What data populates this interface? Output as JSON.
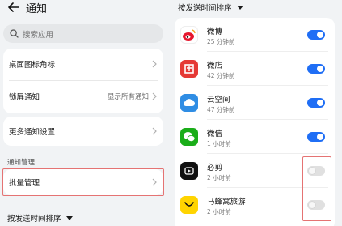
{
  "left_panel": {
    "title": "通知",
    "search_placeholder": "搜索应用",
    "items": [
      {
        "label": "桌面图标角标"
      },
      {
        "label": "锁屏通知",
        "value": "显示所有通知"
      },
      {
        "label": "更多通知设置"
      },
      {
        "label": "批量管理"
      }
    ],
    "section_label": "通知管理",
    "sort_label": "按发送时间排序"
  },
  "right_panel": {
    "sort_label": "按发送时间排序",
    "apps": [
      {
        "name": "微博",
        "time": "25 分钟前",
        "enabled": true,
        "icon": "weibo-icon",
        "color": "#ffffff"
      },
      {
        "name": "微店",
        "time": "42 分钟前",
        "enabled": true,
        "icon": "weidian-icon",
        "color": "#e53935"
      },
      {
        "name": "云空间",
        "time": "47 分钟前",
        "enabled": true,
        "icon": "cloud-icon",
        "color": "#2f8de4"
      },
      {
        "name": "微信",
        "time": "1 小时前",
        "enabled": true,
        "icon": "wechat-icon",
        "color": "#1aad19"
      },
      {
        "name": "必剪",
        "time": "2 小时前",
        "enabled": false,
        "icon": "bijian-icon",
        "color": "#111111"
      },
      {
        "name": "马蜂窝旅游",
        "time": "2 小时前",
        "enabled": false,
        "icon": "mafengwo-icon",
        "color": "#ffd400"
      }
    ]
  },
  "colors": {
    "accent": "#1f6ef5",
    "highlight": "#e57373",
    "background": "#f1f3f5"
  }
}
